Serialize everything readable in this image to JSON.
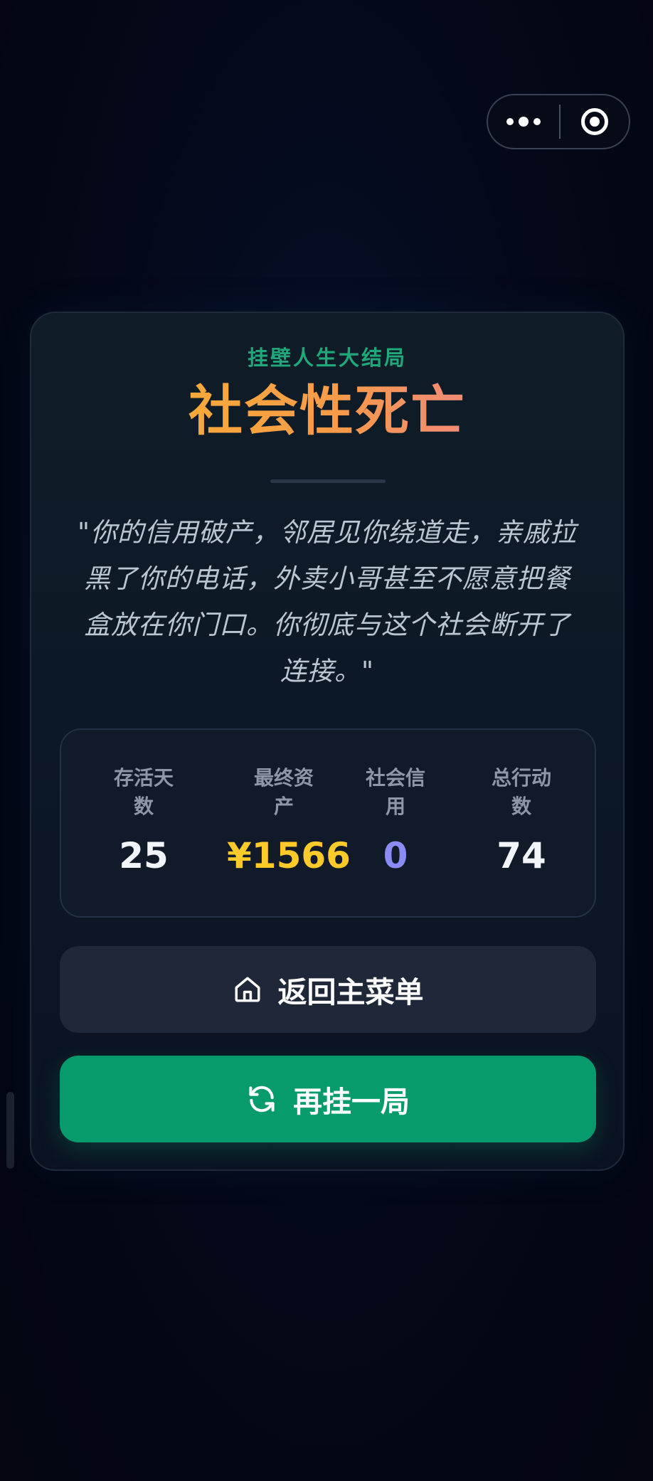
{
  "capsule": {
    "more_icon": "more-dots-icon",
    "close_icon": "record-circle-icon"
  },
  "result": {
    "subtitle": "挂壁人生大结局",
    "title": "社会性死亡",
    "quote": "\"你的信用破产，邻居见你绕道走，亲戚拉黑了你的电话，外卖小哥甚至不愿意把餐盒放在你门口。你彻底与这个社会断开了连接。\""
  },
  "stats": [
    {
      "label": "存活天数",
      "value": "25",
      "color": "#f1f4f8"
    },
    {
      "label": "最终资产",
      "value": "¥1566",
      "color": "#fccb2a"
    },
    {
      "label": "社会信用",
      "value": "0",
      "color": "#8a8cf3"
    },
    {
      "label": "总行动数",
      "value": "74",
      "color": "#f1f4f8"
    }
  ],
  "buttons": {
    "home_label": "返回主菜单",
    "home_icon": "home-icon",
    "restart_label": "再挂一局",
    "restart_icon": "refresh-icon"
  },
  "colors": {
    "accent_green": "#079a6c",
    "subtitle_green": "#1fa87a",
    "title_gradient_start": "#f7a93a",
    "title_gradient_end": "#f08a78"
  }
}
